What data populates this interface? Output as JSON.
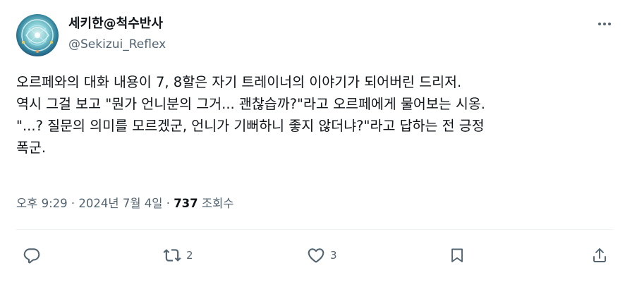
{
  "author": {
    "display_name": "세키한@척수반사",
    "handle": "@Sekizui_Reflex"
  },
  "tweet": {
    "lines": [
      "오르페와의 대화 내용이 7, 8할은 자기 트레이너의 이야기가 되어버린 드리저.",
      "역시 그걸 보고 \"뭔가 언니분의 그거... 괜찮습까?\"라고 오르페에게 물어보는 시옹.",
      "\"...? 질문의 의미를 모르겠군, 언니가 기뻐하니 좋지 않더냐?\"라고 답하는 전 긍정",
      "폭군."
    ]
  },
  "meta": {
    "time": "오후 9:29",
    "date": "2024년 7월 4일",
    "views_count": "737",
    "views_label": "조회수"
  },
  "actions": {
    "reply_count": "",
    "retweet_count": "2",
    "like_count": "3"
  },
  "icons": {
    "more": "more-dots-icon",
    "reply": "reply-icon",
    "retweet": "retweet-icon",
    "like": "heart-icon",
    "bookmark": "bookmark-icon",
    "share": "share-icon"
  },
  "colors": {
    "text": "#0f1419",
    "secondary": "#536471",
    "divider": "#eff3f4"
  }
}
